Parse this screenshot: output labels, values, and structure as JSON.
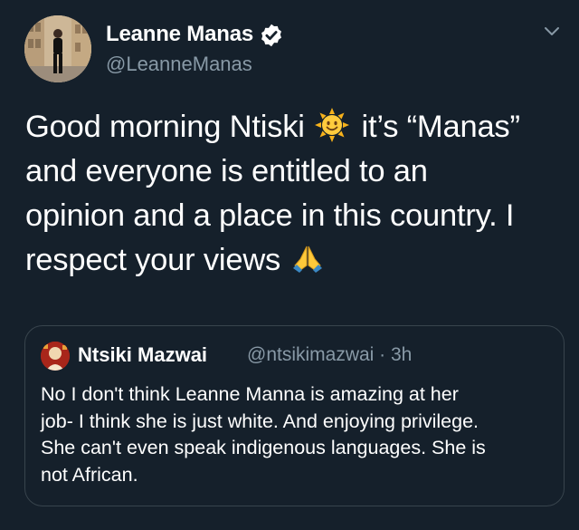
{
  "tweet": {
    "author_name": "Leanne Manas",
    "author_handle": "@LeanneManas",
    "lines": [
      {
        "before": "Good morning Ntiski ",
        "emoji": "sun-face-emoji",
        "after": " it’s “Manas”"
      },
      {
        "text": "and everyone is entitled to an"
      },
      {
        "text": "opinion and a place in this country. I"
      },
      {
        "before": "respect your views ",
        "emoji": "folded-hands-emoji",
        "after": ""
      }
    ]
  },
  "quoted_tweet": {
    "author_name": "Ntsiki Mazwai",
    "meta": "@ntsikimazwai · 3h",
    "lines": [
      "No I don't think Leanne Manna is amazing at her",
      "job- I think she is just white. And enjoying privilege.",
      "She can't even speak indigenous languages. She is",
      "not African."
    ]
  },
  "colors": {
    "background": "#15202b",
    "secondary_text": "#8899a6",
    "verified_badge": "#ffffff",
    "border": "#38444d"
  },
  "icons": [
    "verified-badge-icon",
    "chevron-down-icon",
    "sun-face-emoji",
    "folded-hands-emoji"
  ]
}
